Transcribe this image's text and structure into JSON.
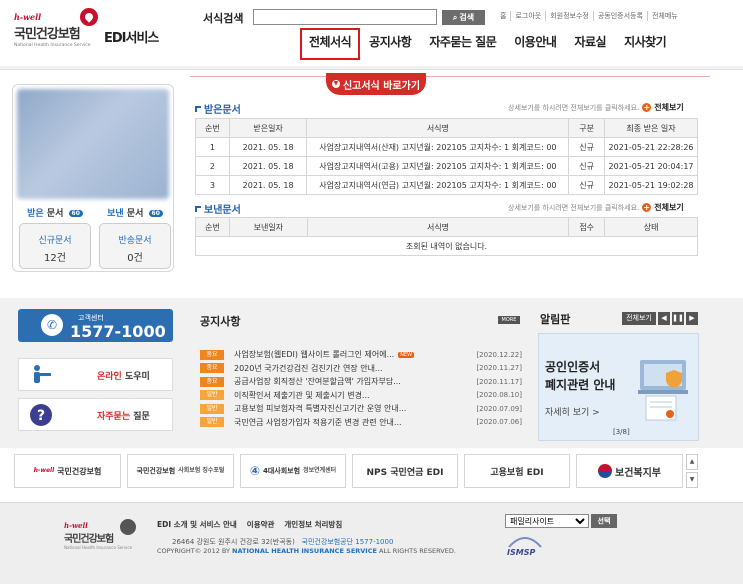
{
  "header": {
    "logo_tagline": "h-well",
    "logo_name": "국민건강보험",
    "logo_english": "National Health Insurance Service",
    "service_title": "EDI서비스",
    "search_label": "서식검색",
    "search_value": "",
    "search_button": "검색",
    "util_links": [
      "홈",
      "로그아웃",
      "회원정보수정",
      "공동인증서등록",
      "전체메뉴"
    ],
    "gnb": [
      "전체서식",
      "공지사항",
      "자주묻는 질문",
      "이용안내",
      "자료실",
      "지사찾기"
    ],
    "quick_tab": "신고서식 바로가기"
  },
  "user_panel": {
    "received": {
      "title_accent": "받은",
      "title_rest": "문서",
      "badge": "60",
      "card_label": "신규문서",
      "card_count": "12건"
    },
    "sent": {
      "title_accent": "보낸",
      "title_rest": "문서",
      "badge": "60",
      "card_label": "반송문서",
      "card_count": "0건"
    }
  },
  "received_docs": {
    "title": "받은문서",
    "hint": "상세보기를 하시려면 전체보기를 클릭하세요.",
    "more": "전체보기",
    "columns": [
      "순번",
      "받은일자",
      "서식명",
      "구분",
      "최종 받은 일자"
    ],
    "rows": [
      [
        "1",
        "2021. 05. 18",
        "사업장고지내역서(산재) 고지년월: 202105 고지차수: 1 회계코드: 00",
        "신규",
        "2021-05-21 22:28:26"
      ],
      [
        "2",
        "2021. 05. 18",
        "사업장고지내역서(고용) 고지년월: 202105 고지차수: 1 회계코드: 00",
        "신규",
        "2021-05-21 20:04:17"
      ],
      [
        "3",
        "2021. 05. 18",
        "사업장고지내역서(연금) 고지년월: 202105 고지차수: 1 회계코드: 00",
        "신규",
        "2021-05-21 19:02:28"
      ]
    ]
  },
  "sent_docs": {
    "title": "보낸문서",
    "hint": "상세보기를 하시려면 전체보기를 클릭하세요.",
    "more": "전체보기",
    "columns": [
      "순번",
      "보낸일자",
      "서식명",
      "접수",
      "상태"
    ],
    "empty": "조회된 내역이 없습니다."
  },
  "callcenter": {
    "label": "고객센터",
    "number": "1577-1000"
  },
  "help": {
    "online": {
      "red": "온라인",
      "rest": " 도우미"
    },
    "faq": {
      "red": "자주묻는",
      "rest": " 질문"
    }
  },
  "notice": {
    "title": "공지사항",
    "more": "MORE",
    "items": [
      {
        "tag": "중요",
        "subject": "사업장보험(웹EDI) 웹사이트 롤러그인 제어에...",
        "new": "NEW",
        "date": "[2020.12.22]"
      },
      {
        "tag": "중요",
        "subject": "2020년 국가건강검진 검진기간 연장 안내...",
        "new": "",
        "date": "[2020.11.27]"
      },
      {
        "tag": "중요",
        "subject": "공급사업장 회직정산 '잔여분할금액' 가입자부담...",
        "new": "",
        "date": "[2020.11.17]"
      },
      {
        "tag": "일반",
        "subject": "이직확인서 제출기관 및 제출시기 변경...",
        "new": "",
        "date": "[2020.08.10]"
      },
      {
        "tag": "일반",
        "subject": "고용보험 피보험자격 특별자진신고기간 운영 안내...",
        "new": "",
        "date": "[2020.07.09]"
      },
      {
        "tag": "일반",
        "subject": "국민연금 사업장가입자 적용기준 변경 관련 안내...",
        "new": "",
        "date": "[2020.07.06]"
      }
    ]
  },
  "alarm": {
    "title": "알림판",
    "all_button": "전체보기",
    "line1": "공인인증서",
    "line2": "폐지관련 안내",
    "more": "자세히 보기 >",
    "pager": "[3/8]"
  },
  "partners": [
    {
      "main": "국민건강보험",
      "sub": "h-well"
    },
    {
      "main": "국민건강보험",
      "sub": "사회보험 징수포털"
    },
    {
      "main": "4대사회보험",
      "sub": "정보연계센터"
    },
    {
      "main": "NPS 국민연금 EDI",
      "sub": ""
    },
    {
      "main": "고용보험 EDI",
      "sub": ""
    },
    {
      "main": "보건복지부",
      "sub": ""
    }
  ],
  "footer": {
    "links": [
      "EDI 소개 및 서비스 안내",
      "이용약관",
      "개인정보 처리방침"
    ],
    "address": "26464  강원도 원주시 건강로 32(반곡동)",
    "address_org": "국민건강보험공단  1577-1000",
    "copy_pre": "COPYRIGHT© 2012 BY ",
    "copy_org": "NATIONAL HEALTH INSURANCE SERVICE",
    "copy_post": " ALL RIGHTS RESERVED.",
    "family_select": "패밀리사이트",
    "family_button": "선택",
    "isms": "ISMSP"
  },
  "colors": {
    "accent_red": "#d42c27",
    "accent_blue": "#2d6eb3",
    "tag_orange": "#f0851e"
  }
}
